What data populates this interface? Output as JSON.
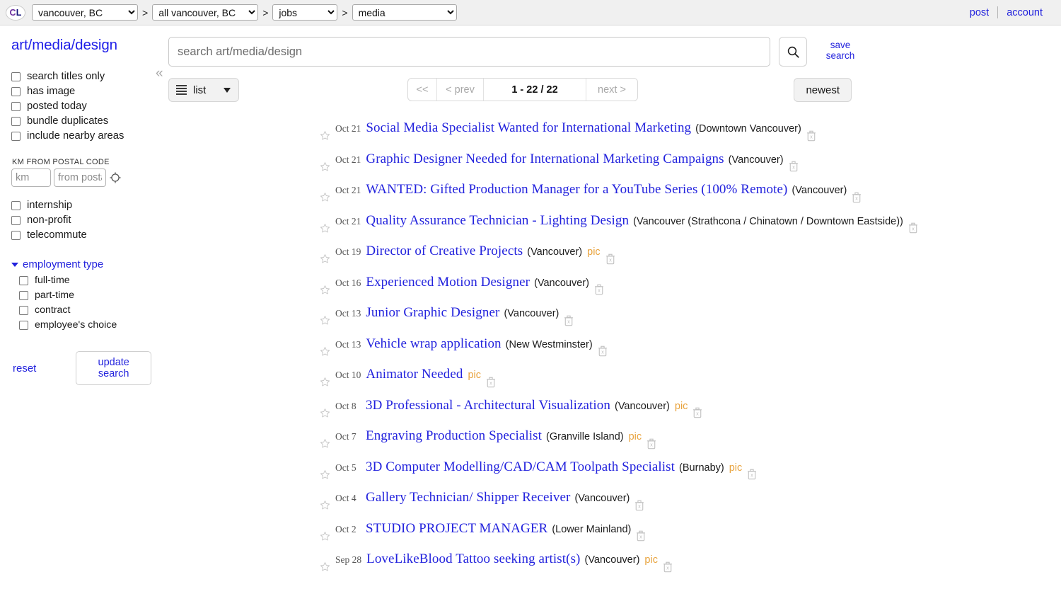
{
  "header": {
    "logo": {
      "c": "CL",
      "part1": "C",
      "part2": "L"
    },
    "breadcrumbs": [
      {
        "name": "region-select",
        "value": "vancouver, BC"
      },
      {
        "name": "subarea-select",
        "value": "all vancouver, BC"
      },
      {
        "name": "category-group-select",
        "value": "jobs"
      },
      {
        "name": "category-select",
        "value": "media"
      }
    ],
    "separator": ">",
    "post_label": "post",
    "account_label": "account"
  },
  "sidebar": {
    "category_title": "art/media/design",
    "checkboxes": [
      {
        "label": "search titles only",
        "checked": false
      },
      {
        "label": "has image",
        "checked": false
      },
      {
        "label": "posted today",
        "checked": false
      },
      {
        "label": "bundle duplicates",
        "checked": false
      },
      {
        "label": "include nearby areas",
        "checked": false
      }
    ],
    "postal": {
      "heading": "KM FROM POSTAL CODE",
      "distance_placeholder": "km",
      "distance_value": "",
      "postal_placeholder": "from postal code",
      "postal_value": "",
      "locate_icon": "crosshair-icon"
    },
    "checkboxes2": [
      {
        "label": "internship",
        "checked": false
      },
      {
        "label": "non-profit",
        "checked": false
      },
      {
        "label": "telecommute",
        "checked": false
      }
    ],
    "employment_type": {
      "label": "employment type",
      "expanded": true,
      "options": [
        {
          "label": "full-time",
          "checked": false
        },
        {
          "label": "part-time",
          "checked": false
        },
        {
          "label": "contract",
          "checked": false
        },
        {
          "label": "employee's choice",
          "checked": false
        }
      ]
    },
    "reset_label": "reset",
    "update_label": "update search"
  },
  "main": {
    "collapse_icon": "chevron-double-left-icon",
    "search": {
      "placeholder": "search art/media/design",
      "value": "",
      "button_icon": "search-icon",
      "save_search_label": "save\nsearch",
      "save_search_line1": "save",
      "save_search_line2": "search"
    },
    "toolbar": {
      "view_mode_label": "list",
      "view_mode_icon": "list-icon",
      "view_mode_caret": "chevron-down-icon",
      "pagination": {
        "first_label": "<<",
        "prev_label": "< prev",
        "count_label": "1 - 22 / 22",
        "next_label": "next >",
        "first_disabled": true,
        "prev_disabled": true,
        "next_disabled": true
      },
      "sort_label": "newest"
    },
    "listings": [
      {
        "date": "Oct 21",
        "title": "Social Media Specialist Wanted for International Marketing",
        "hood": "(Downtown Vancouver)",
        "pic": ""
      },
      {
        "date": "Oct 21",
        "title": "Graphic Designer Needed for International Marketing Campaigns",
        "hood": "(Vancouver)",
        "pic": ""
      },
      {
        "date": "Oct 21",
        "title": "WANTED: Gifted Production Manager for a YouTube Series (100% Remote)",
        "hood": "(Vancouver)",
        "pic": ""
      },
      {
        "date": "Oct 21",
        "title": "Quality Assurance Technician - Lighting Design",
        "hood": "(Vancouver (Strathcona / Chinatown / Downtown Eastside))",
        "pic": ""
      },
      {
        "date": "Oct 19",
        "title": "Director of Creative Projects",
        "hood": "(Vancouver)",
        "pic": "pic"
      },
      {
        "date": "Oct 16",
        "title": "Experienced Motion Designer",
        "hood": "(Vancouver)",
        "pic": ""
      },
      {
        "date": "Oct 13",
        "title": "Junior Graphic Designer",
        "hood": "(Vancouver)",
        "pic": ""
      },
      {
        "date": "Oct 13",
        "title": "Vehicle wrap application",
        "hood": "(New Westminster)",
        "pic": ""
      },
      {
        "date": "Oct 10",
        "title": "Animator Needed",
        "hood": "",
        "pic": "pic"
      },
      {
        "date": "Oct 8",
        "title": "3D Professional - Architectural Visualization",
        "hood": "(Vancouver)",
        "pic": "pic"
      },
      {
        "date": "Oct 7",
        "title": "Engraving Production Specialist",
        "hood": "(Granville Island)",
        "pic": "pic"
      },
      {
        "date": "Oct 5",
        "title": "3D Computer Modelling/CAD/CAM Toolpath Specialist",
        "hood": "(Burnaby)",
        "pic": "pic"
      },
      {
        "date": "Oct 4",
        "title": "Gallery Technician/ Shipper Receiver",
        "hood": "(Vancouver)",
        "pic": ""
      },
      {
        "date": "Oct 2",
        "title": "STUDIO PROJECT MANAGER",
        "hood": "(Lower Mainland)",
        "pic": ""
      },
      {
        "date": "Sep 28",
        "title": "LoveLikeBlood Tattoo seeking artist(s)",
        "hood": "(Vancouver)",
        "pic": "pic"
      }
    ],
    "row_icons": {
      "favorite": "star-icon",
      "hide": "trash-icon"
    }
  },
  "colors": {
    "link": "#2222dd",
    "pic_tag": "#e8a33d",
    "header_bg": "#f0f0f0",
    "logo_c": "#6a2b9c",
    "logo_l": "#13137a"
  }
}
